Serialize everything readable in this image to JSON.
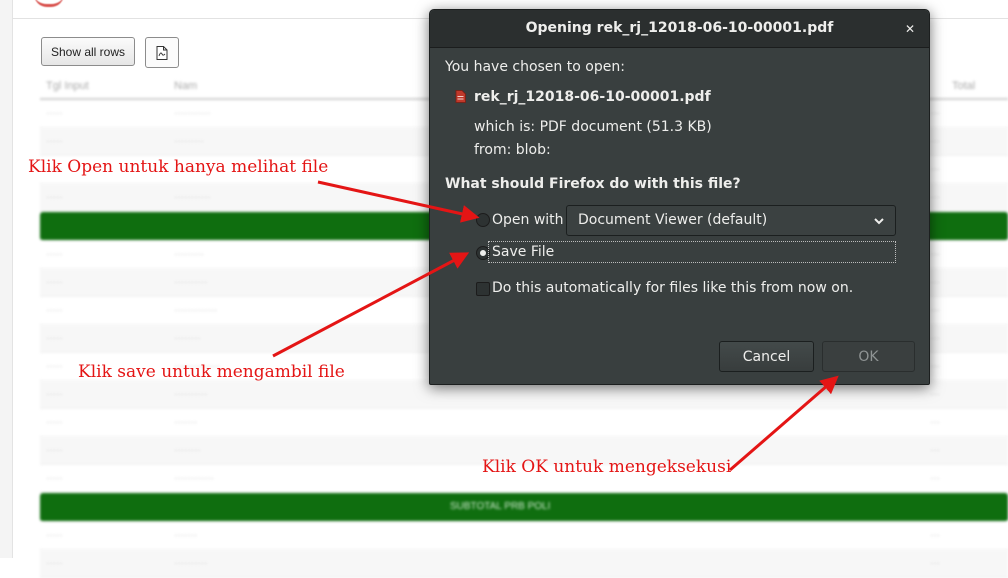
{
  "background": {
    "show_all_button": "Show all rows",
    "pdf_icon": "pdf-file-icon",
    "table_headers": [
      "Tgl Input",
      "Nam",
      "Total"
    ],
    "subtotal_label": "SUBTOTAL PRB POLI"
  },
  "dialog": {
    "title": "Opening rek_rj_12018-06-10-00001.pdf",
    "chosen_label": "You have chosen to open:",
    "file_icon": "pdf-file-icon",
    "filename": "rek_rj_12018-06-10-00001.pdf",
    "which_is": "which is: PDF document (51.3 KB)",
    "from": "from: blob:",
    "question": "What should Firefox do with this file?",
    "open_with_label": "Open with",
    "open_with_app": "Document Viewer (default)",
    "save_file_label": "Save File",
    "selected_option": "Save File",
    "auto_label": "Do this automatically for files like this from now on.",
    "auto_checked": false,
    "cancel_label": "Cancel",
    "ok_label": "OK",
    "close_icon": "close-icon",
    "dropdown_icon": "chevron-down-icon"
  },
  "annotations": {
    "open_note": "Klik Open untuk hanya melihat file",
    "save_note": "Klik save untuk mengambil file",
    "ok_note": "Klik OK untuk mengeksekusi",
    "color": "#e41515"
  },
  "colors": {
    "dialog_bg": "#393f3f",
    "titlebar_bg": "#2b2f2f",
    "subtotal_row": "#0f6e0f"
  }
}
